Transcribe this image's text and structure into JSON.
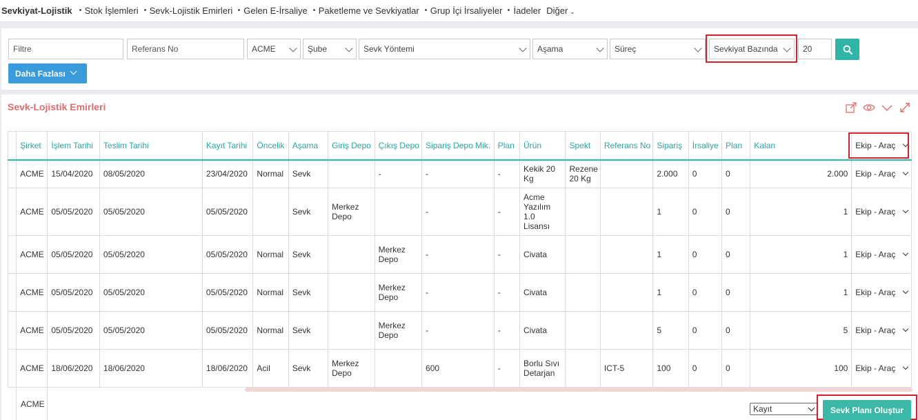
{
  "nav": {
    "brand": "Sevkiyat-Lojistik",
    "items": [
      "Stok İşlemleri",
      "Sevk-Lojistik Emirleri",
      "Gelen E-İrsaliye",
      "Paketleme ve Sevkiyatlar",
      "Grup İçi İrsaliyeler",
      "İadeler"
    ],
    "more": "Diğer"
  },
  "filters": {
    "filtre_placeholder": "Filtre",
    "referans_placeholder": "Referans No",
    "company": "ACME",
    "sube": "Şube",
    "sevk_yontemi": "Sevk Yöntemi",
    "asama": "Aşama",
    "surec": "Süreç",
    "bazinda": "Sevkiyat Bazında",
    "page_size": "20",
    "more_label": "Daha Fazlası"
  },
  "panel": {
    "title": "Sevk-Lojistik Emirleri"
  },
  "table": {
    "headers": [
      "Şirket",
      "İşlem Tarihi",
      "Teslim Tarihi",
      "Kayıt Tarihi",
      "Öncelik",
      "Aşama",
      "Giriş Depo",
      "Çıkış Depo",
      "Sipariş Depo Mik.",
      "Plan",
      "Ürün",
      "Spekt",
      "Referans No",
      "Sipariş",
      "İrsaliye",
      "Plan",
      "Kalan",
      "Ekip - Araç"
    ],
    "rows": [
      [
        "ACME",
        "15/04/2020",
        "08/05/2020",
        "23/04/2020",
        "Normal",
        "Sevk",
        "",
        "-",
        "-",
        "-",
        "Kekik 20 Kg",
        "Rezene 20 Kg",
        "",
        "2.000",
        "0",
        "0",
        "2.000",
        "Ekip - Araç"
      ],
      [
        "ACME",
        "05/05/2020",
        "05/05/2020",
        "05/05/2020",
        "",
        "Sevk",
        "Merkez Depo",
        "",
        "-",
        "-",
        "Acme Yazılım 1.0 Lisansı",
        "",
        "",
        "1",
        "0",
        "0",
        "1",
        "Ekip - Araç"
      ],
      [
        "ACME",
        "05/05/2020",
        "05/05/2020",
        "05/05/2020",
        "Normal",
        "Sevk",
        "",
        "Merkez Depo",
        "-",
        "-",
        "Civata",
        "",
        "",
        "1",
        "0",
        "0",
        "1",
        "Ekip - Araç"
      ],
      [
        "ACME",
        "05/05/2020",
        "05/05/2020",
        "05/05/2020",
        "Normal",
        "Sevk",
        "",
        "Merkez Depo",
        "-",
        "-",
        "Civata",
        "",
        "",
        "1",
        "0",
        "0",
        "1",
        "Ekip - Araç"
      ],
      [
        "ACME",
        "05/05/2020",
        "05/05/2020",
        "05/05/2020",
        "Normal",
        "Sevk",
        "",
        "Merkez Depo",
        "-",
        "-",
        "Civata",
        "",
        "",
        "5",
        "0",
        "0",
        "5",
        "Ekip - Araç"
      ],
      [
        "ACME",
        "18/06/2020",
        "18/06/2020",
        "18/06/2020",
        "Acil",
        "Sevk",
        "Merkez Depo",
        "",
        "600",
        "-",
        "Borlu Sıvı Detarjan",
        "",
        "ICT-5",
        "100",
        "0",
        "0",
        "100",
        "Ekip - Araç"
      ]
    ],
    "last_row_company": "ACME"
  },
  "footer": {
    "kayit_select": "Kayıt",
    "create_button": "Sevk Planı Oluştur"
  },
  "colors": {
    "accent_teal": "#2eb5a6",
    "blue_button": "#3a9bdc",
    "title_red": "#e26d6d",
    "highlight_red": "#d9202a"
  }
}
